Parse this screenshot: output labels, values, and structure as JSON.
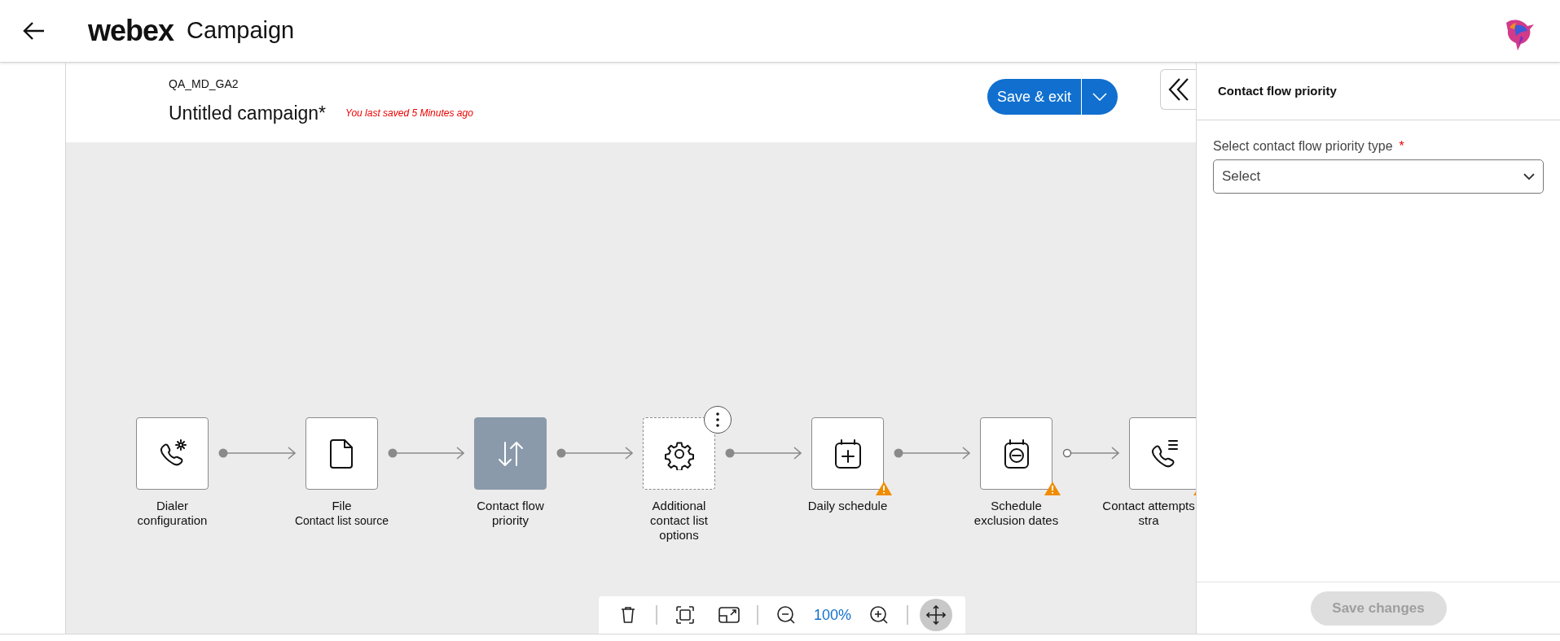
{
  "header": {
    "logo": "webex",
    "title": "Campaign"
  },
  "campaign": {
    "folder": "QA_MD_GA2",
    "name": "Untitled campaign*",
    "saved_note": "You last saved 5 Minutes ago",
    "save_button": "Save & exit"
  },
  "flow": {
    "nodes": [
      {
        "label": "Dialer configuration",
        "selected": false,
        "optional": false,
        "warning": false,
        "menu": false,
        "out_filled": true
      },
      {
        "label": "File",
        "sublabel": "Contact list source",
        "selected": false,
        "optional": false,
        "warning": false,
        "menu": false,
        "out_filled": true
      },
      {
        "label": "Contact flow priority",
        "selected": true,
        "optional": false,
        "warning": false,
        "menu": false,
        "out_filled": true
      },
      {
        "label": "Additional contact list options",
        "selected": false,
        "optional": true,
        "warning": false,
        "menu": true,
        "out_filled": true
      },
      {
        "label": "Daily schedule",
        "selected": false,
        "optional": false,
        "warning": true,
        "menu": false,
        "out_filled": true
      },
      {
        "label": "Schedule exclusion dates",
        "selected": false,
        "optional": false,
        "warning": true,
        "menu": false,
        "out_filled": false
      },
      {
        "label": "Contact attempts stra",
        "selected": false,
        "optional": false,
        "warning": true,
        "menu": false
      }
    ]
  },
  "toolbar": {
    "zoom": "100%",
    "pan_mode": true
  },
  "panel": {
    "title": "Contact flow priority",
    "field_label": "Select contact flow priority type",
    "required_mark": "*",
    "placeholder": "Select",
    "save_button": "Save changes",
    "save_disabled": true
  }
}
